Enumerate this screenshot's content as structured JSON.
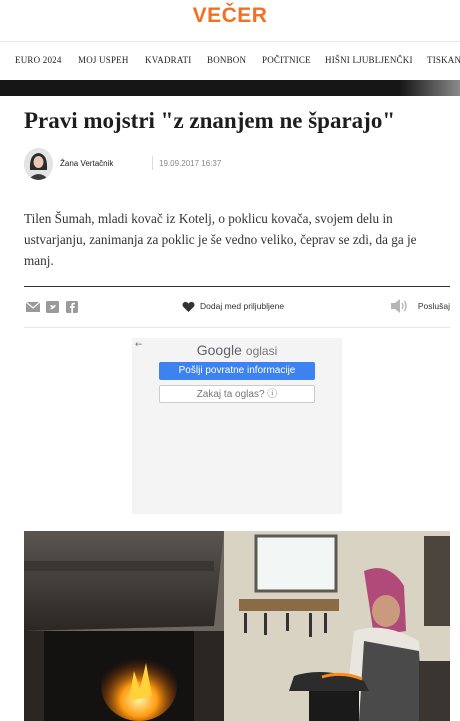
{
  "header": {
    "logo": "VEČER",
    "brand_color": "#f36f21"
  },
  "nav": {
    "items": [
      "EURO 2024",
      "MOJ USPEH",
      "KVADRATI",
      "BONBON",
      "POČITNICE",
      "HIŠNI LJUBLJENČKI",
      "TISKANA IZDAJA"
    ]
  },
  "article": {
    "title": "Pravi mojstri \"z znanjem ne šparajo\"",
    "author": "Žana Vertačnik",
    "date": "19.09.2017 16:37",
    "lead": "Tilen Šumah, mladi kovač iz Kotelj, o poklicu kovača, svojem delu in ustvarjanju, zanimanja za poklic je še vedno veliko, čeprav se zdi, da ga je manj."
  },
  "share": {
    "icons": [
      "email-icon",
      "twitter-icon",
      "facebook-icon"
    ],
    "favorite_label": "Dodaj med priljubljene",
    "listen_label": "Poslušaj"
  },
  "ad": {
    "back_arrow": "←",
    "brand": "Google",
    "brand_suffix": "oglasi",
    "feedback_button": "Pošlji povratne informacije",
    "why_button": "Zakaj ta oglas? ⓘ"
  }
}
